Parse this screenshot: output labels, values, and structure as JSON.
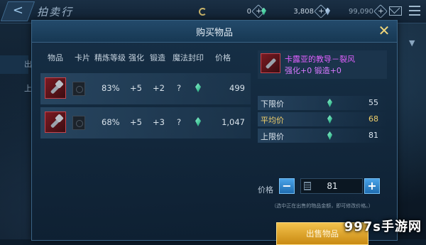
{
  "header": {
    "back_label": "<",
    "title": "拍卖行",
    "currencies": [
      {
        "icon": "coin-icon",
        "value": "0"
      },
      {
        "icon": "gem-icon",
        "value": "3,808"
      },
      {
        "icon": "diamond-icon",
        "value": "99,090"
      }
    ],
    "plus": "+"
  },
  "side_tabs": [
    "出",
    "上"
  ],
  "dialog": {
    "title": "购买物品",
    "close": "✕",
    "columns": [
      "物品",
      "卡片",
      "精炼等级",
      "强化",
      "锻造",
      "魔法封印",
      "价格"
    ],
    "rows": [
      {
        "refine": "83%",
        "enhance": "+5",
        "forge": "+2",
        "seal": "?",
        "price": "499"
      },
      {
        "refine": "68%",
        "enhance": "+5",
        "forge": "+3",
        "seal": "?",
        "price": "1,047"
      }
    ],
    "detail": {
      "name": "卡露亚的教导－裂风",
      "stats": "强化+0 锻造+0"
    },
    "price_rows": [
      {
        "label": "下限价",
        "value": "55"
      },
      {
        "label": "平均价",
        "value": "68"
      },
      {
        "label": "上限价",
        "value": "81"
      }
    ],
    "price_label": "价格",
    "minus": "−",
    "plus": "+",
    "price_value": "81",
    "hint": "（选中正在出售的物品金额，即可修改价格。）",
    "sell_button": "出售物品"
  },
  "watermark": "997s手游网",
  "colors": {
    "accent": "#f3c24d",
    "purple": "#e060ff",
    "gem": "#17a474"
  }
}
